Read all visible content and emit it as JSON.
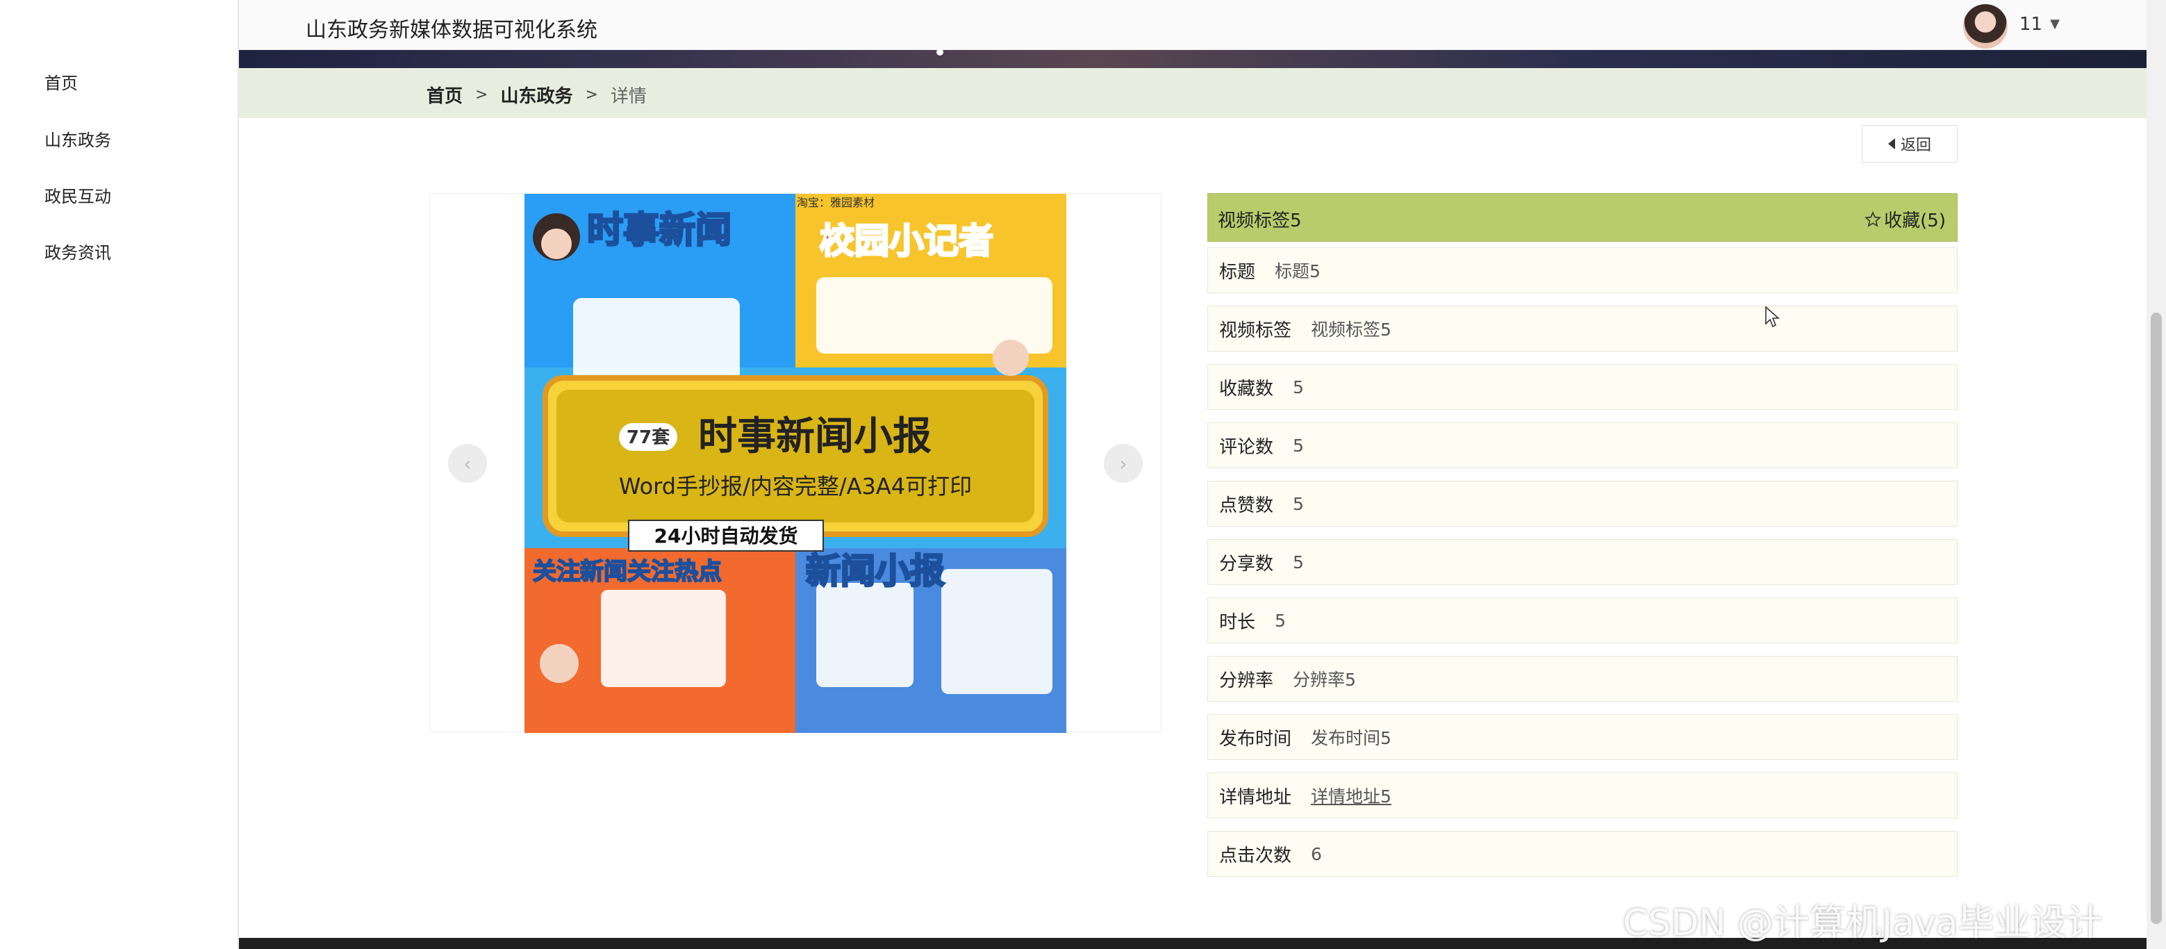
{
  "app": {
    "title": "山东政务新媒体数据可视化系统"
  },
  "user": {
    "name": "11"
  },
  "sidebar": {
    "items": [
      {
        "label": "首页"
      },
      {
        "label": "山东政务"
      },
      {
        "label": "政民互动"
      },
      {
        "label": "政务资讯"
      }
    ]
  },
  "breadcrumb": {
    "home": "首页",
    "section": "山东政务",
    "current": "详情",
    "separator": ">"
  },
  "back_button": {
    "label": "返回"
  },
  "carousel": {
    "image": {
      "top_left_title": "时事新闻",
      "top_right_title": "校园小记者",
      "count": "77套",
      "main_title": "时事新闻小报",
      "subtitle": "Word手抄报/内容完整/A3A4可打印",
      "ship": "24小时自动发货",
      "bottom_left_title": "关注新闻关注热点",
      "bottom_right_title": "新闻小报",
      "shop_tag": "淘宝：雅园素材"
    },
    "prev_label": "‹",
    "next_label": "›"
  },
  "detail": {
    "header_title": "视频标签5",
    "favorite_label": "收藏(5)",
    "rows": [
      {
        "label": "标题",
        "value": "标题5"
      },
      {
        "label": "视频标签",
        "value": "视频标签5"
      },
      {
        "label": "收藏数",
        "value": "5"
      },
      {
        "label": "评论数",
        "value": "5"
      },
      {
        "label": "点赞数",
        "value": "5"
      },
      {
        "label": "分享数",
        "value": "5"
      },
      {
        "label": "时长",
        "value": "5"
      },
      {
        "label": "分辨率",
        "value": "分辨率5"
      },
      {
        "label": "发布时间",
        "value": "发布时间5"
      },
      {
        "label": "详情地址",
        "value": "详情地址5"
      },
      {
        "label": "点击次数",
        "value": "6"
      }
    ]
  },
  "watermark": "CSDN @计算机Java毕业设计",
  "colors": {
    "accent": "#b9cc6c",
    "breadcrumb_bg": "#e8eedf",
    "row_bg": "#fdfdf4"
  }
}
